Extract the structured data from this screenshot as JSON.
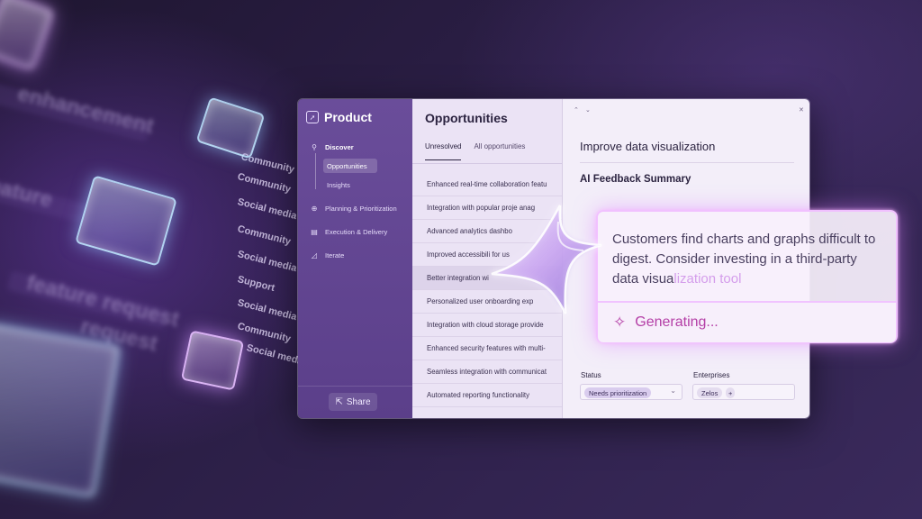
{
  "background": {
    "floating_labels": [
      "Community",
      "Community",
      "Social media",
      "Community",
      "Social media",
      "Support",
      "Social media",
      "Community",
      "Social media"
    ],
    "blurred_labels": [
      "enhancement",
      "feature",
      "feature request",
      "request"
    ]
  },
  "sidebar": {
    "title": "Product",
    "logo_icon": "rocket-icon",
    "items": [
      {
        "label": "Discover",
        "icon": "search-icon",
        "active": true
      },
      {
        "label": "Planning & Prioritization",
        "icon": "globe-icon"
      },
      {
        "label": "Execution & Delivery",
        "icon": "calendar-icon"
      },
      {
        "label": "Iterate",
        "icon": "chart-icon"
      }
    ],
    "subitems": [
      {
        "label": "Opportunities",
        "active": true
      },
      {
        "label": "Insights"
      }
    ],
    "share_label": "Share"
  },
  "list": {
    "title": "Opportunities",
    "tabs": [
      {
        "label": "Unresolved",
        "active": true
      },
      {
        "label": "All opportunities"
      }
    ],
    "rows": [
      "Enhanced real-time collaboration featu",
      "Integration with popular proje  anag",
      "Advanced analytics dashbo",
      "Improved accessibili     for us",
      "Better integration wi",
      "Personalized user onboarding exp",
      "Integration with cloud storage provide",
      "Enhanced security features with multi-",
      "Seamless integration with communicat",
      "Automated reporting functionality"
    ]
  },
  "detail": {
    "title": "Improve data visualization",
    "subtitle": "AI Feedback Summary",
    "status_label": "Status",
    "status_value": "Needs prioritization",
    "enterprises_label": "Enterprises",
    "enterprise_value": "Zelos",
    "add_symbol": "+"
  },
  "ai": {
    "summary_main": "Customers find charts and graphs difficult to digest. Consider investing in a third-party data visua",
    "summary_fading": "lization tool",
    "generating_label": "Generating...",
    "icon": "sparkle-icon"
  },
  "colors": {
    "sidebar": "#5b3f8a",
    "accent": "#b43ea6",
    "glow": "#f0beff"
  }
}
